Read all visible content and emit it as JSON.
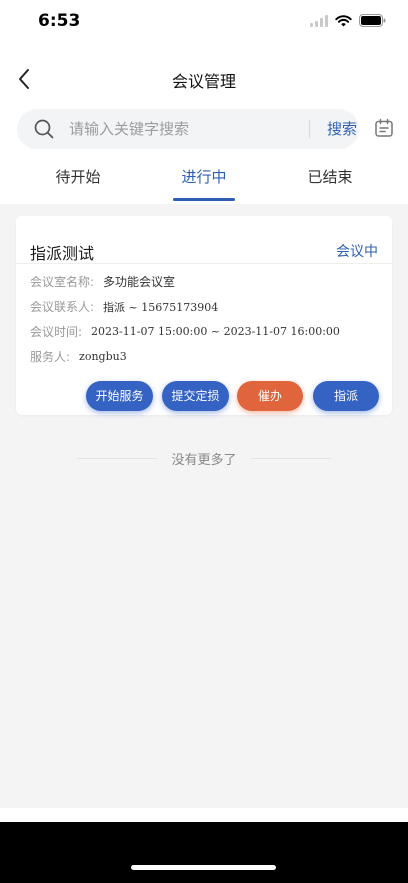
{
  "status_bar": {
    "time": "6:53"
  },
  "nav": {
    "title": "会议管理"
  },
  "search": {
    "placeholder": "请输入关键字搜索",
    "button_label": "搜索"
  },
  "tabs": [
    {
      "label": "待开始",
      "active": false
    },
    {
      "label": "进行中",
      "active": true
    },
    {
      "label": "已结束",
      "active": false
    }
  ],
  "meeting_card": {
    "title": "指派测试",
    "status": "会议中",
    "rows": [
      {
        "label": "会议室名称:",
        "value": "多功能会议室"
      },
      {
        "label": "会议联系人:",
        "value": "指派 ~ 15675173904"
      },
      {
        "label": "会议时间:",
        "value": "2023-11-07 15:00:00 ~ 2023-11-07 16:00:00"
      },
      {
        "label": "服务人:",
        "value": "zongbu3"
      }
    ],
    "actions": [
      "开始服务",
      "提交定损",
      "催办",
      "指派"
    ]
  },
  "footer": {
    "no_more": "没有更多了"
  },
  "colors": {
    "accent": "#2f5fb3",
    "button_blue": "#3563c4",
    "button_orange": "#e0653d",
    "page_bg": "#f4f4f5"
  }
}
